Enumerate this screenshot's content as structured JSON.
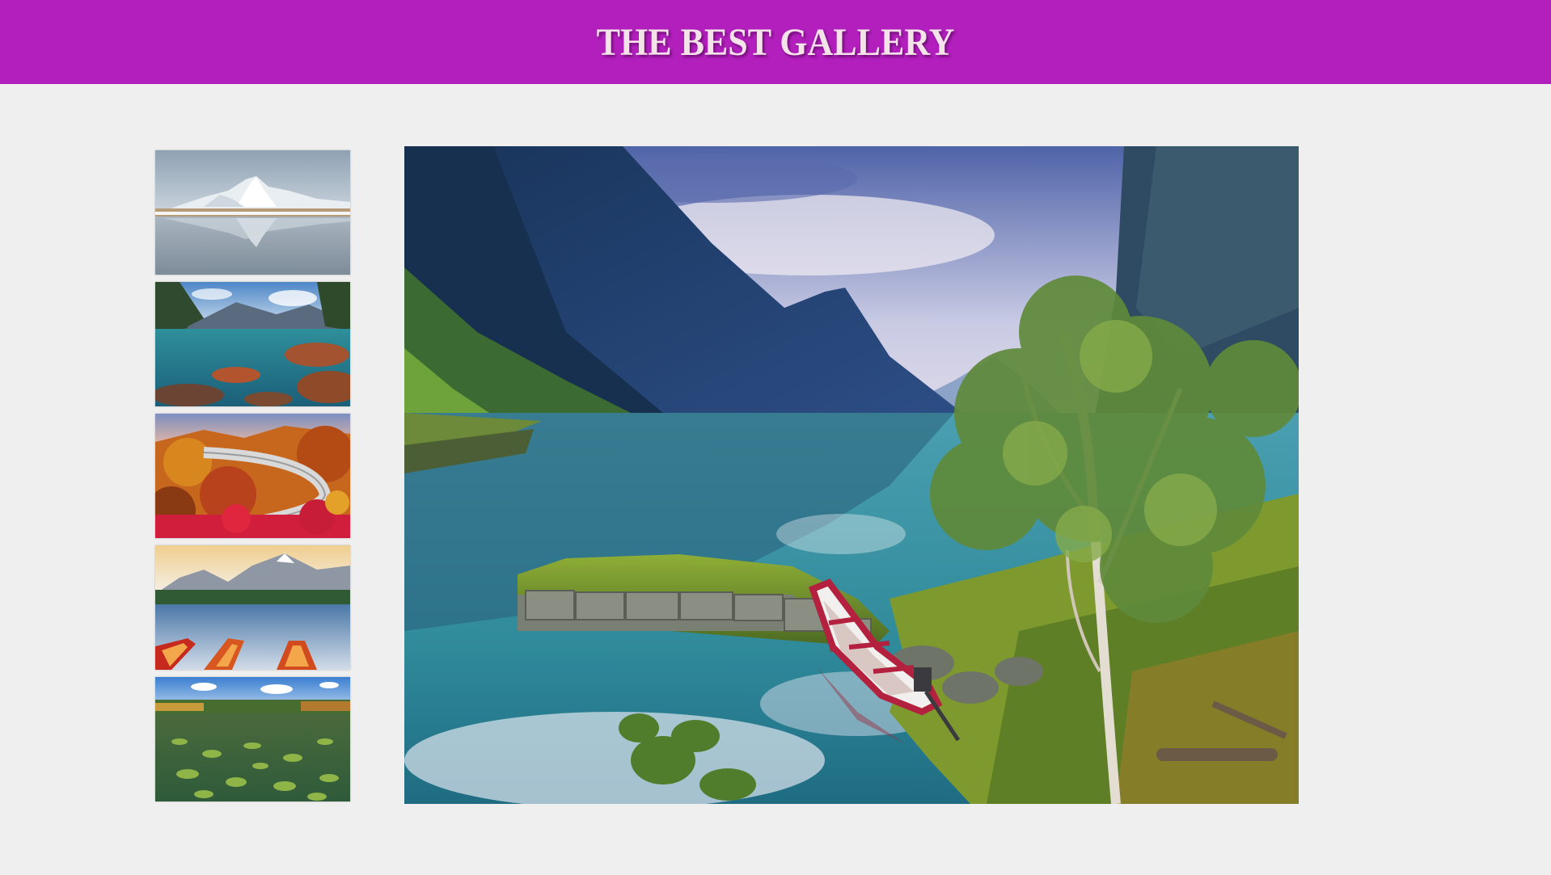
{
  "header": {
    "title": "THE BEST GALLERY"
  },
  "colors": {
    "header_bg": "#b21fbd",
    "page_bg": "#efefef",
    "title_text": "#f4e3e8"
  },
  "gallery": {
    "thumbnails": [
      {
        "name": "snowy-mountain-reflection"
      },
      {
        "name": "clear-lake-rocks"
      },
      {
        "name": "autumn-mountain-road"
      },
      {
        "name": "red-boats-mountain-lake"
      },
      {
        "name": "lily-pad-lake"
      }
    ],
    "main_image": {
      "name": "fjord-lake-boat"
    }
  }
}
